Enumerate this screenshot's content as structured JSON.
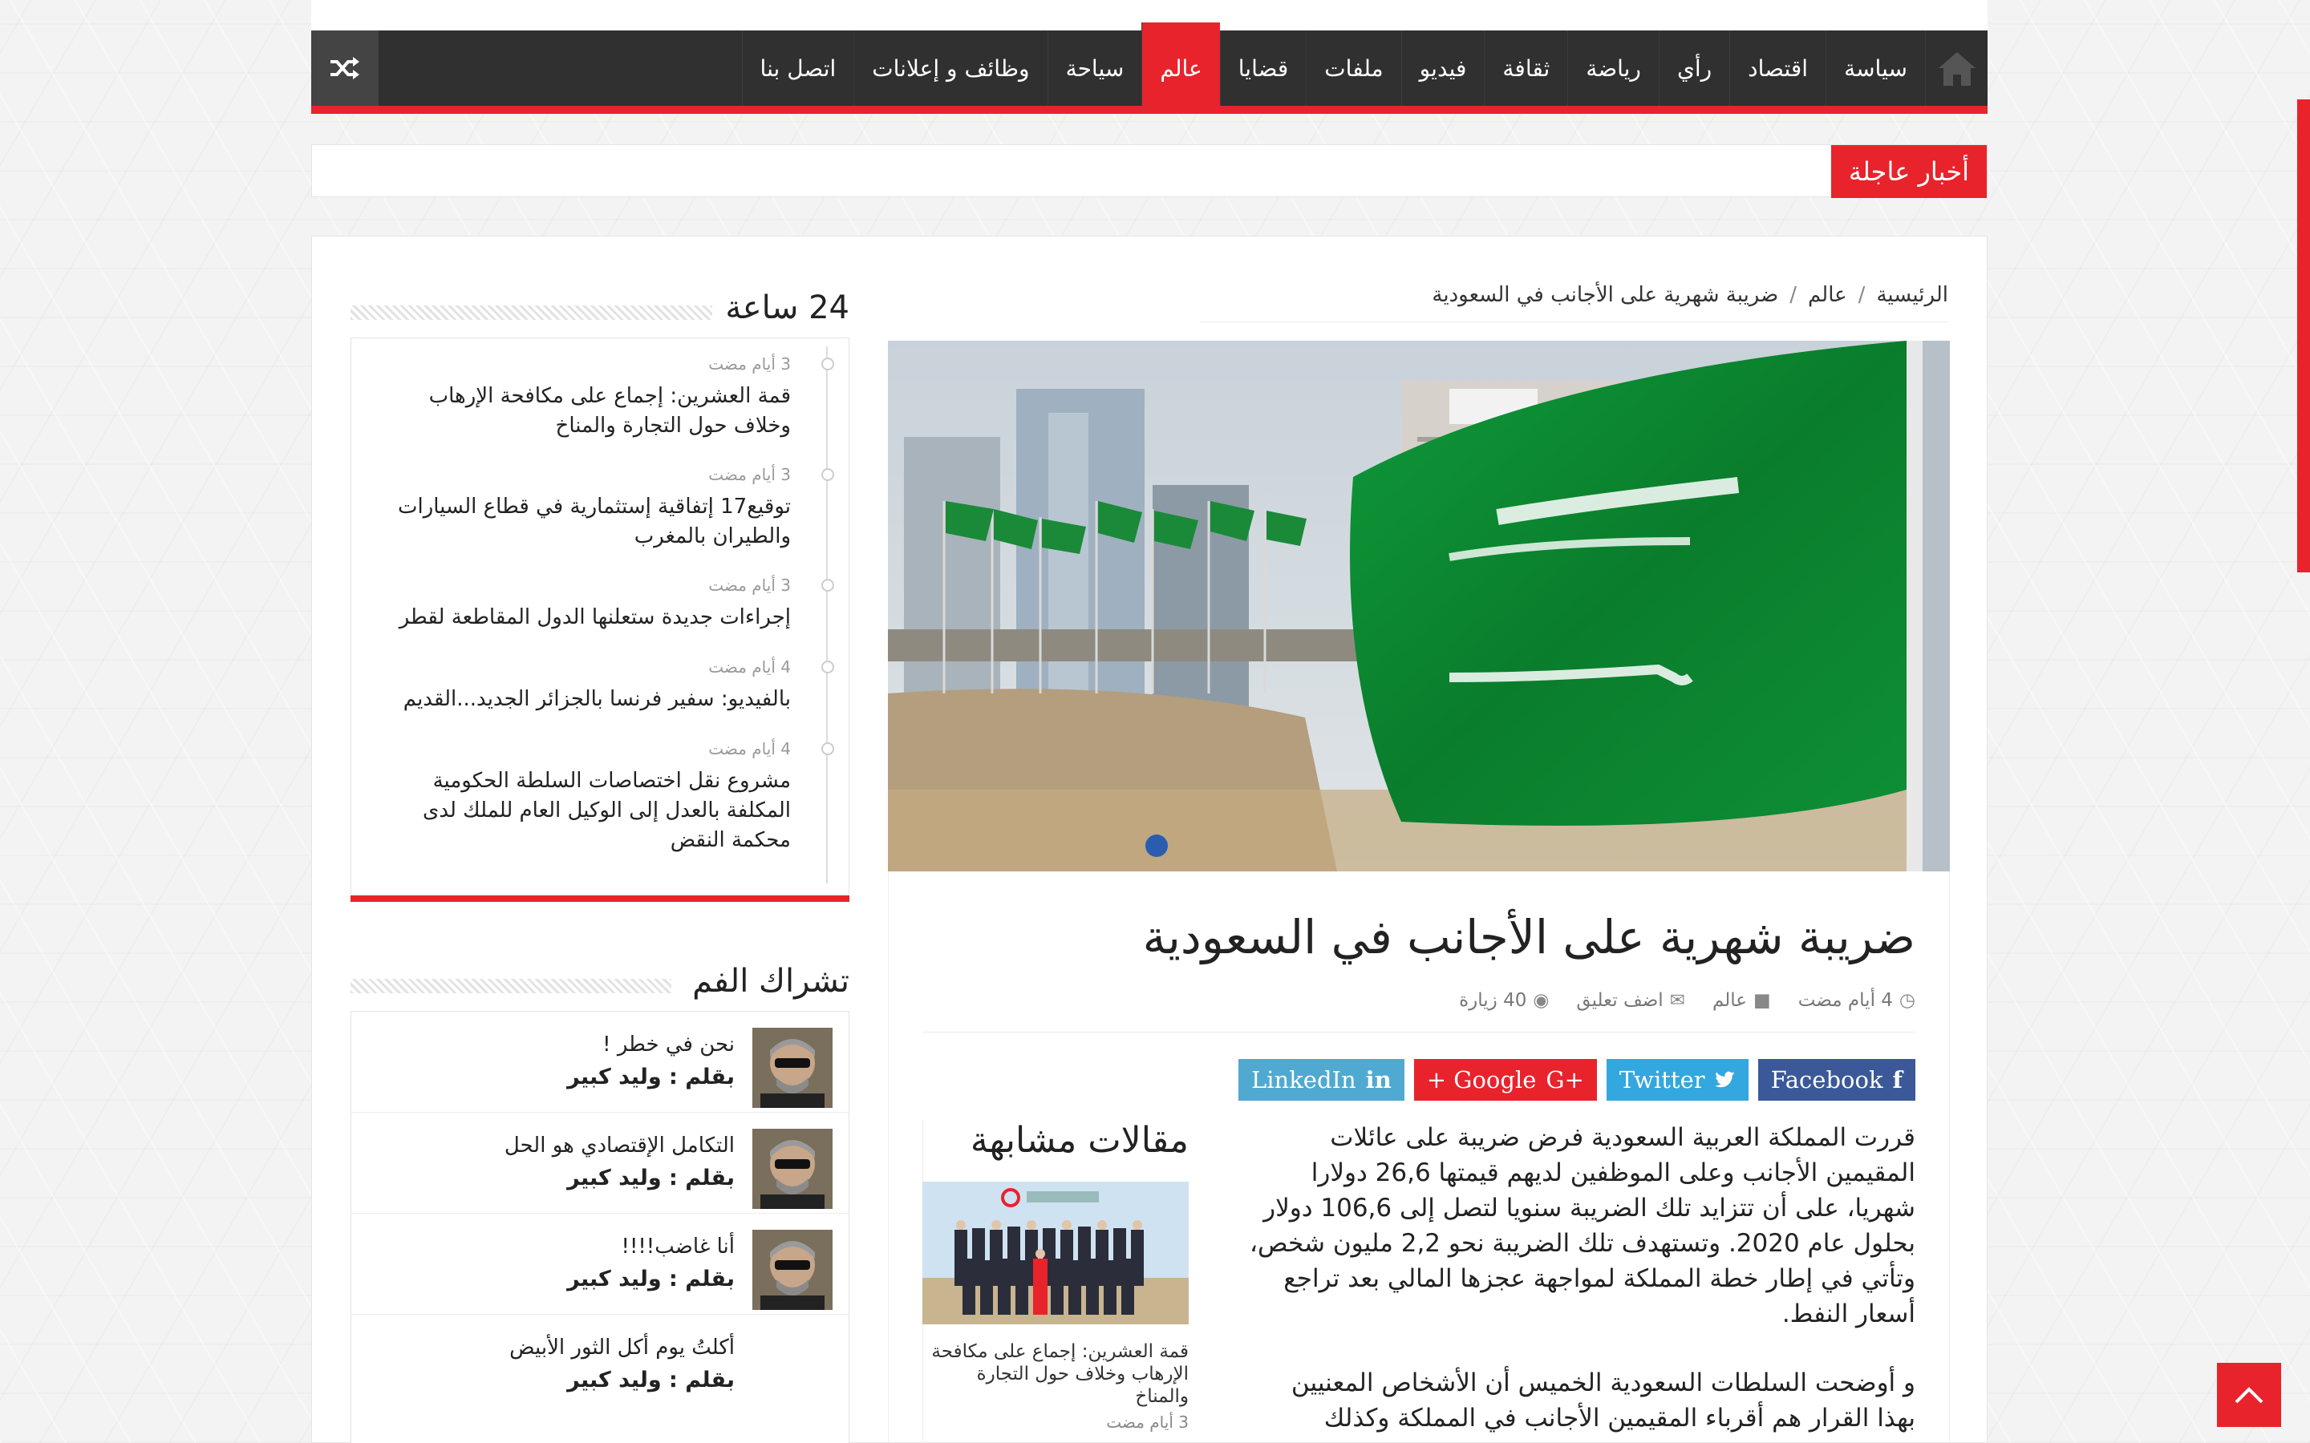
{
  "nav": {
    "items": [
      "سياسة",
      "اقتصاد",
      "رأي",
      "رياضة",
      "ثقافة",
      "فيديو",
      "ملفات",
      "قضايا",
      "عالم",
      "سياحة",
      "وظائف و إعلانات",
      "اتصل بنا"
    ],
    "active_index": 8,
    "icons": {
      "home": "home-icon",
      "random": "shuffle-icon"
    }
  },
  "breaking": {
    "label": "أخبار عاجلة"
  },
  "breadcrumb": {
    "home": "الرئيسية",
    "section": "عالم",
    "current": "ضريبة شهرية على الأجانب في السعودية",
    "sep": "/"
  },
  "article": {
    "title": "ضريبة شهرية على الأجانب في السعودية",
    "date": "4 أيام مضت",
    "category": "عالم",
    "comments": "اضف تعليق",
    "views": "40 زيارة",
    "paragraphs": [
      "قررت المملكة العربية السعودية فرض ضريبة  على عائلات المقيمين الأجانب وعلى الموظفين لديهم قيمتها 26,6 دولارا شهريا، على أن تتزايد تلك الضريبة سنويا لتصل إلى 106,6 دولار بحلول عام 2020. وتستهدف تلك الضريبة نحو 2,2 مليون شخص، وتأتي في إطار خطة المملكة لمواجهة عجزها المالي بعد تراجع أسعار النفط.",
      "و أوضحت السلطات السعودية الخميس أن الأشخاص المعنيين بهذا القرار هم أقرباء المقيمين الأجانب في المملكة وكذلك"
    ]
  },
  "share": {
    "facebook": "Facebook",
    "twitter": "Twitter",
    "google": "+ Google",
    "linkedin": "LinkedIn"
  },
  "related": {
    "heading": "مقالات مشابهة",
    "title": "قمة العشرين: إجماع على مكافحة الإرهاب وخلاف حول التجارة والمناخ",
    "date": "3 أيام مضت"
  },
  "widget24": {
    "heading": "24 ساعة",
    "items": [
      {
        "date": "3 أيام مضت",
        "title": "قمة العشرين: إجماع على مكافحة الإرهاب وخلاف حول التجارة والمناخ"
      },
      {
        "date": "3 أيام مضت",
        "title": "توقيع17 إتفاقية إستثمارية في قطاع السيارات والطيران بالمغرب"
      },
      {
        "date": "3 أيام مضت",
        "title": "إجراءات جديدة ستعلنها الدول المقاطعة لقطر"
      },
      {
        "date": "4 أيام مضت",
        "title": "بالفيديو: سفير فرنسا بالجزائر الجديد...القديم"
      },
      {
        "date": "4 أيام مضت",
        "title": "مشروع نقل اختصاصات السلطة الحكومية المكلفة بالعدل إلى الوكيل العام للملك لدى محكمة النقض"
      }
    ]
  },
  "opinions": {
    "heading": "تشراك الفم",
    "items": [
      {
        "title": "نحن في خطر !",
        "author": "بقلم : وليد كبير"
      },
      {
        "title": "التكامل الإقتصادي هو الحل",
        "author": "بقلم : وليد كبير"
      },
      {
        "title": "أنا غاضب!!!!",
        "author": "بقلم : وليد كبير"
      },
      {
        "title": "أكلتُ يوم أكل الثور الأبيض",
        "author": "بقلم : وليد كبير"
      }
    ]
  },
  "colors": {
    "accent": "#e8232c",
    "nav_bg": "#303030",
    "facebook": "#3b5998",
    "twitter": "#32a7e0",
    "linkedin": "#4fa9d1"
  }
}
